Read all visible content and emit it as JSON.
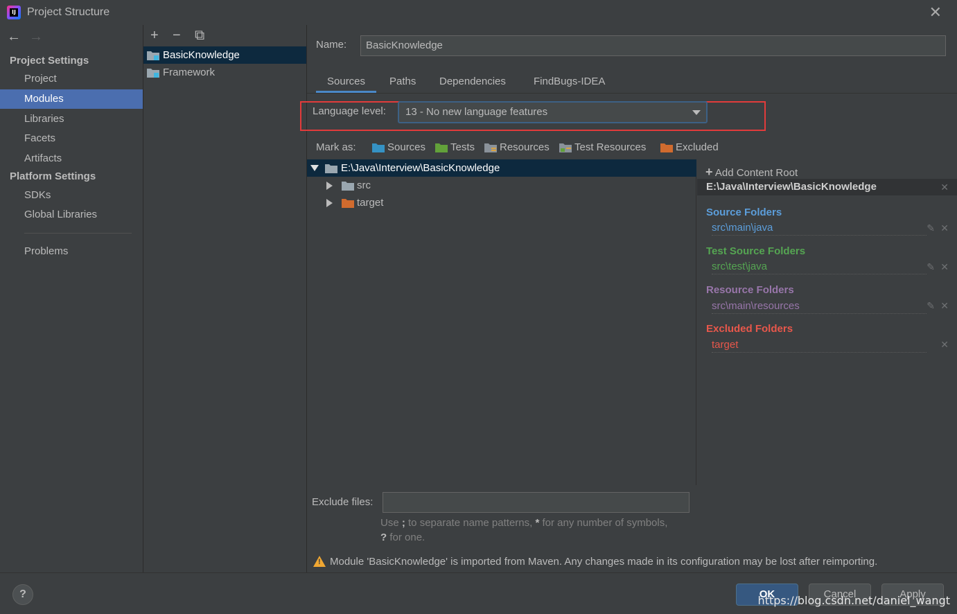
{
  "window": {
    "title": "Project Structure",
    "close": "✕",
    "app_icon_text": "IJ"
  },
  "sidebar": {
    "back": "←",
    "forward": "→",
    "project_settings": "Project Settings",
    "project_items": [
      "Project",
      "Modules",
      "Libraries",
      "Facets",
      "Artifacts"
    ],
    "platform_settings": "Platform Settings",
    "platform_items": [
      "SDKs",
      "Global Libraries"
    ],
    "problems": "Problems"
  },
  "modules": {
    "add": "+",
    "remove": "−",
    "copy": "⧉",
    "items": [
      "BasicKnowledge",
      "Framework"
    ]
  },
  "main": {
    "name_label": "Name:",
    "name_value": "BasicKnowledge",
    "tabs": [
      "Sources",
      "Paths",
      "Dependencies",
      "FindBugs-IDEA"
    ],
    "language_label": "Language level:",
    "language_value": "13 - No new language features",
    "mark_as": "Mark as:",
    "marks": [
      "Sources",
      "Tests",
      "Resources",
      "Test Resources",
      "Excluded"
    ],
    "tree": {
      "root": "E:\\Java\\Interview\\BasicKnowledge",
      "children": [
        "src",
        "target"
      ]
    },
    "content_root": {
      "add": "Add Content Root",
      "path": "E:\\Java\\Interview\\BasicKnowledge",
      "source_head": "Source Folders",
      "source_path": "src\\main\\java",
      "test_head": "Test Source Folders",
      "test_path": "src\\test\\java",
      "res_head": "Resource Folders",
      "res_path": "src\\main\\resources",
      "excl_head": "Excluded Folders",
      "excl_path": "target"
    },
    "exclude_label": "Exclude files:",
    "hint_part1": "Use ",
    "hint_semicolon": ";",
    "hint_part2": " to separate name patterns, ",
    "hint_star": "*",
    "hint_part3": " for any number of symbols, ",
    "hint_q": "?",
    "hint_part4": " for one.",
    "warning": "Module 'BasicKnowledge' is imported from Maven. Any changes made in its configuration may be lost after reimporting."
  },
  "footer": {
    "help": "?",
    "ok": "OK",
    "cancel": "Cancel",
    "apply": "Apply",
    "watermark": "https://blog.csdn.net/daniel_wangt"
  },
  "colors": {
    "accent": "#4b6eaf",
    "source": "#5c9edb",
    "test": "#55a552",
    "resource": "#9876aa",
    "excluded": "#e8574b",
    "highlight": "#e23b3b"
  }
}
